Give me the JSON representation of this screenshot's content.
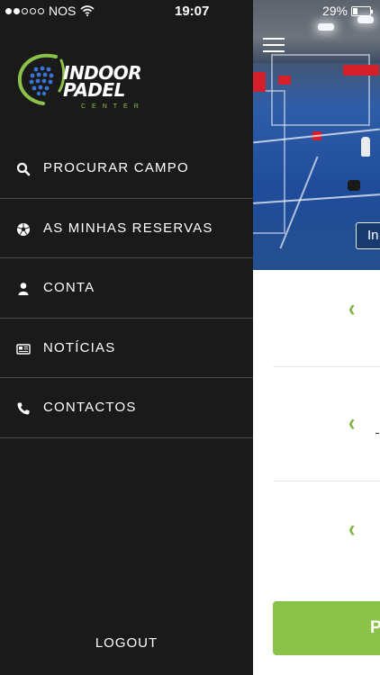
{
  "status_bar": {
    "carrier": "NOS",
    "time": "19:07",
    "battery": "29%",
    "signal_bars_filled": 2,
    "signal_bars_total": 5
  },
  "drawer": {
    "logo": {
      "line1": "INDOOR",
      "line2": "PADEL",
      "line3": "CENTER"
    },
    "menu": [
      {
        "label": "PROCURAR CAMPO",
        "icon": "search-icon"
      },
      {
        "label": "AS MINHAS RESERVAS",
        "icon": "soccer-ball-icon"
      },
      {
        "label": "CONTA",
        "icon": "user-icon"
      },
      {
        "label": "NOTÍCIAS",
        "icon": "newspaper-icon"
      },
      {
        "label": "CONTACTOS",
        "icon": "phone-icon"
      }
    ],
    "logout": "LOGOUT"
  },
  "content": {
    "hero_button": "In",
    "primary_button": "P",
    "chevron": "‹"
  },
  "colors": {
    "drawer_bg": "#1b1a1b",
    "accent_green": "#8bc34a",
    "divider": "#4a494c"
  }
}
